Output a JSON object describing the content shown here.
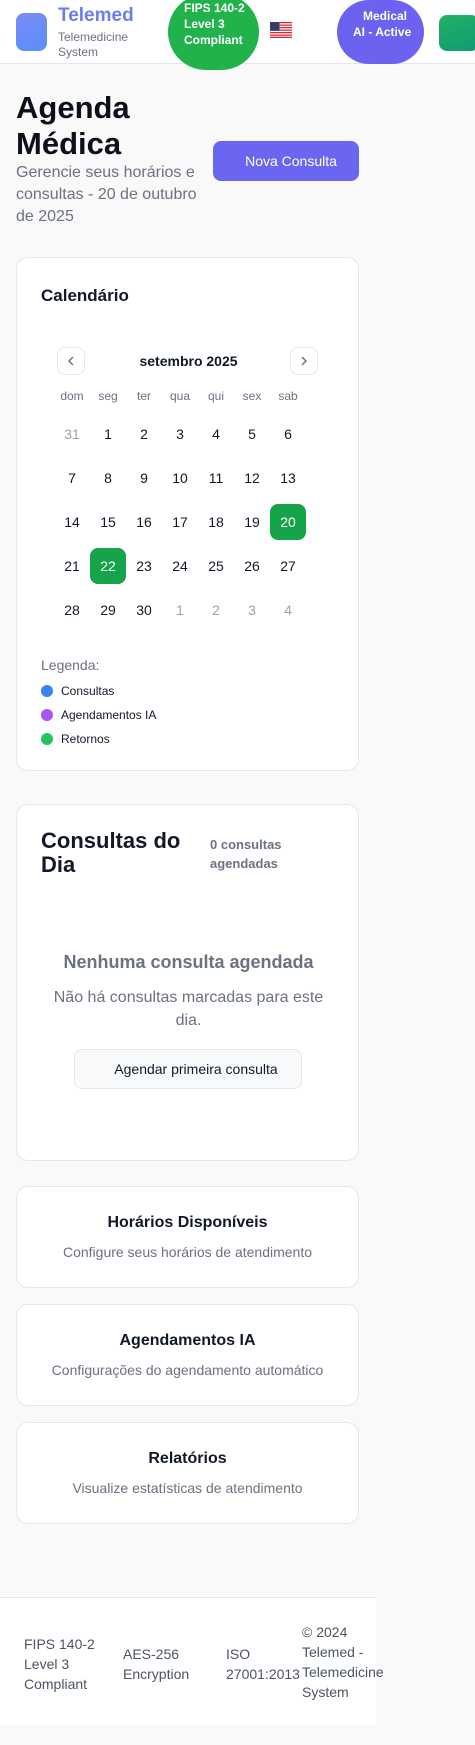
{
  "header": {
    "brand": "Telemed",
    "brand_sub": "Telemedicine System",
    "fips_badge": "FIPS 140-2 Level 3 Compliant",
    "flag": "us-flag",
    "ai_badge_line1": "Medical",
    "ai_badge_line2": "AI - Active"
  },
  "page": {
    "title": "Agenda Médica",
    "subtitle": "Gerencie seus horários e consultas - 20 de outubro de 2025",
    "new_button": "Nova Consulta"
  },
  "calendar": {
    "title": "Calendário",
    "month": "setembro 2025",
    "weekdays": [
      "dom",
      "seg",
      "ter",
      "qua",
      "qui",
      "sex",
      "sab"
    ],
    "weeks": [
      [
        "31",
        "1",
        "2",
        "3",
        "4",
        "5",
        "6"
      ],
      [
        "7",
        "8",
        "9",
        "10",
        "11",
        "12",
        "13"
      ],
      [
        "14",
        "15",
        "16",
        "17",
        "18",
        "19",
        "20"
      ],
      [
        "21",
        "22",
        "23",
        "24",
        "25",
        "26",
        "27"
      ],
      [
        "28",
        "29",
        "30",
        "1",
        "2",
        "3",
        "4"
      ]
    ],
    "legend_title": "Legenda:",
    "legend": [
      {
        "label": "Consultas",
        "color": "#3b82f6"
      },
      {
        "label": "Agendamentos IA",
        "color": "#a855f7"
      },
      {
        "label": "Retornos",
        "color": "#22c55e"
      }
    ]
  },
  "consults": {
    "title": "Consultas do Dia",
    "count": "0 consultas agendadas",
    "empty_title": "Nenhuma consulta agendada",
    "empty_text": "Não há consultas marcadas para este dia.",
    "first_button": "Agendar primeira consulta"
  },
  "cards": [
    {
      "title": "Horários Disponíveis",
      "subtitle": "Configure seus horários de atendimento"
    },
    {
      "title": "Agendamentos IA",
      "subtitle": "Configurações do agendamento automático"
    },
    {
      "title": "Relatórios",
      "subtitle": "Visualize estatísticas de atendimento"
    }
  ],
  "footer": {
    "fips": "FIPS 140-2 Level 3 Compliant",
    "aes": "AES-256 Encryption",
    "iso": "ISO 27001:2013",
    "copyright": "© 2024 Telemed - Telemedicine System"
  },
  "colors": {
    "accent": "#6b66f2",
    "success": "#16a34a"
  }
}
